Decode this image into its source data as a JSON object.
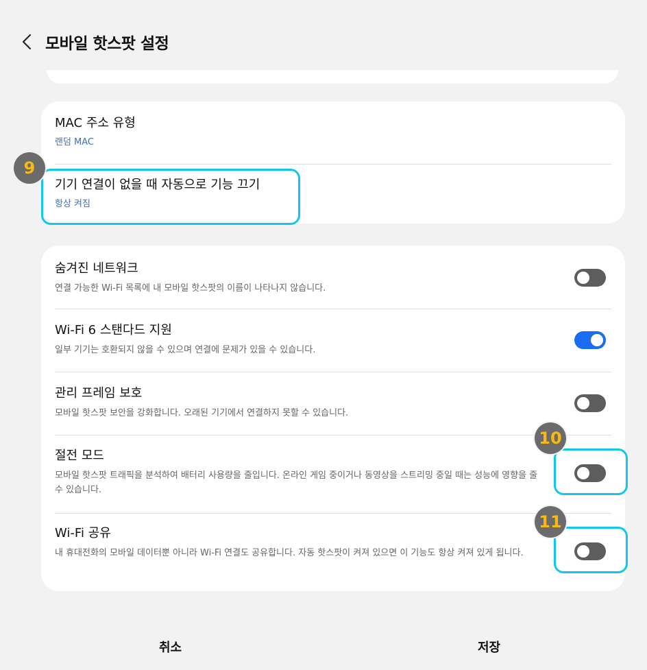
{
  "header": {
    "title": "모바일 핫스팟 설정",
    "back_icon": "chevron-left-icon"
  },
  "card1": {
    "mac": {
      "title": "MAC 주소 유형",
      "value": "랜덤 MAC"
    },
    "auto_off": {
      "title": "기기 연결이 없을 때 자동으로 기능 끄기",
      "value": "항상 켜짐"
    }
  },
  "card2": {
    "hidden_network": {
      "title": "숨겨진 네트워크",
      "desc": "연결 가능한 Wi-Fi 목록에 내 모바일 핫스팟의 이름이 나타나지 않습니다.",
      "enabled": false
    },
    "wifi6": {
      "title": "Wi-Fi 6 스탠다드 지원",
      "desc": "일부 기기는 호환되지 않을 수 있으며 연결에 문제가 있을 수 있습니다.",
      "enabled": true
    },
    "pmf": {
      "title": "관리 프레임 보호",
      "desc": "모바일 핫스팟 보안을 강화합니다. 오래된 기기에서 연결하지 못할 수 있습니다.",
      "enabled": false
    },
    "power_saving": {
      "title": "절전 모드",
      "desc": "모바일 핫스팟 트래픽을 분석하여 배터리 사용량을 줄입니다. 온라인 게임 중이거나 동영상을 스트리밍 중일 때는 성능에 영향을 줄 수 있습니다.",
      "enabled": false
    },
    "wifi_share": {
      "title": "Wi-Fi 공유",
      "desc": "내 휴대전화의 모바일 데이터뿐 아니라 Wi-Fi 연결도 공유합니다. 자동 핫스팟이 켜져 있으면 이 기능도 항상 켜져 있게 됩니다.",
      "enabled": false
    }
  },
  "annotations": {
    "badge9": "9",
    "badge10": "10",
    "badge11": "11"
  },
  "footer": {
    "cancel": "취소",
    "save": "저장"
  },
  "colors": {
    "accent": "#1a6cf0",
    "link": "#3a6fc8",
    "highlight": "#12c7ee",
    "badge_text": "#f6b918"
  }
}
